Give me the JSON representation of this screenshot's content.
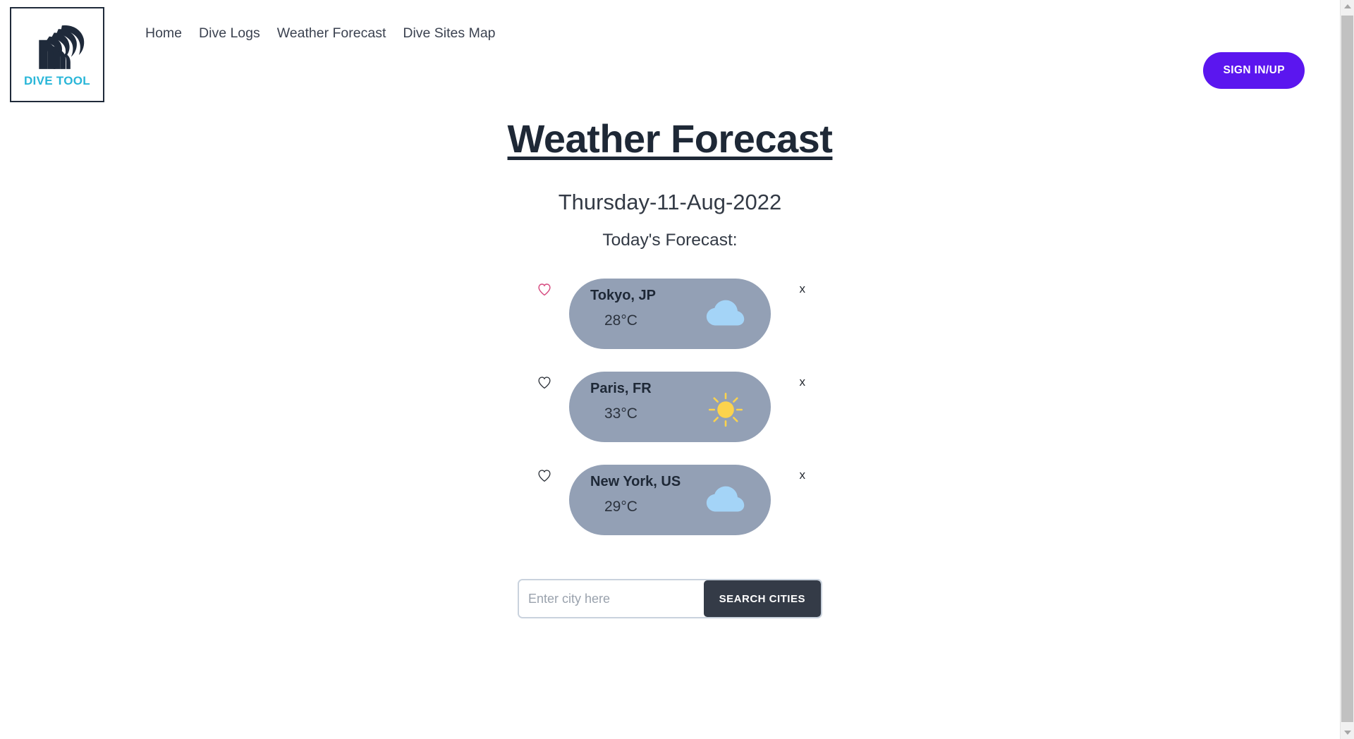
{
  "header": {
    "logo": {
      "icon": "wave-icon",
      "text": "DIVE TOOL",
      "text_color": "#29b6d8"
    },
    "nav_items": [
      {
        "label": "Home"
      },
      {
        "label": "Dive Logs"
      },
      {
        "label": "Weather Forecast"
      },
      {
        "label": "Dive Sites Map"
      }
    ],
    "signin_label": "SIGN IN/UP",
    "signin_color": "#5b16ef"
  },
  "main": {
    "title": "Weather Forecast",
    "date": "Thursday-11-Aug-2022",
    "subtitle": "Today's Forecast:",
    "card_color": "#93a0b5",
    "cards": [
      {
        "city": "Tokyo, JP",
        "temp": "28°C",
        "weather_icon": "cloud-icon",
        "favorite_icon": "heart-icon",
        "favorited": true,
        "favorite_color": "#d6487e",
        "close_label": "x"
      },
      {
        "city": "Paris, FR",
        "temp": "33°C",
        "weather_icon": "sun-icon",
        "favorite_icon": "heart-icon",
        "favorited": false,
        "favorite_color": "#22272f",
        "close_label": "x"
      },
      {
        "city": "New York, US",
        "temp": "29°C",
        "weather_icon": "cloud-icon",
        "favorite_icon": "heart-icon",
        "favorited": false,
        "favorite_color": "#22272f",
        "close_label": "x"
      }
    ]
  },
  "search": {
    "value": "",
    "placeholder": "Enter city here",
    "button_label": "SEARCH CITIES",
    "button_color": "#343b47"
  },
  "scrollbar": {
    "up_arrow": "chevron-up-icon",
    "down_arrow": "chevron-down-icon"
  }
}
